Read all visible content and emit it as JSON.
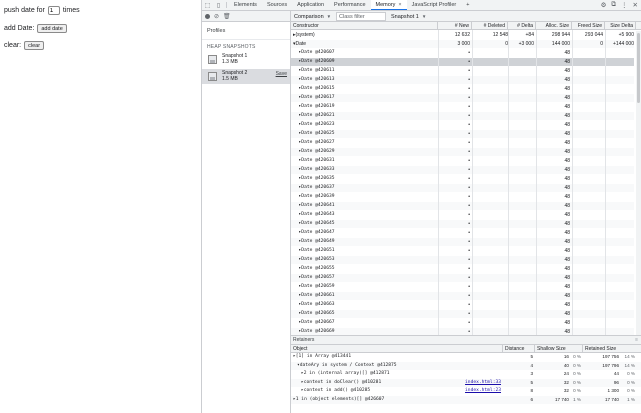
{
  "page": {
    "push_prefix": "push date for",
    "push_count": "1",
    "push_suffix": "times",
    "add_label": "add Date:",
    "add_button": "add date",
    "clear_label": "clear:",
    "clear_button": "clear"
  },
  "devtools": {
    "tabs": [
      {
        "label": "Elements",
        "active": false
      },
      {
        "label": "Sources",
        "active": false
      },
      {
        "label": "Application",
        "active": false
      },
      {
        "label": "Performance",
        "active": false
      },
      {
        "label": "Memory",
        "active": true
      },
      {
        "label": "JavaScript Profiler",
        "active": false
      }
    ],
    "add_tab": "+",
    "close_tab": "×",
    "toolbar": {
      "view_select": "Comparison",
      "class_filter_placeholder": "Class filter",
      "snapshot_select": "Snapshot 1"
    },
    "profiles": {
      "title": "Profiles",
      "heading": "HEAP SNAPSHOTS",
      "snapshots": [
        {
          "name": "Snapshot 1",
          "size": "1.3 MB"
        },
        {
          "name": "Snapshot 2",
          "size": "1.5 MB",
          "save": "Save"
        }
      ]
    },
    "table": {
      "headers": [
        "Constructor",
        "# New",
        "# Deleted",
        "# Delta",
        "Alloc. Size",
        "Freed Size",
        "Size Delta"
      ],
      "summary_rows": [
        {
          "name": "(system)",
          "new": "12 632",
          "deleted": "12 548",
          "delta": "+84",
          "alloc": "298 944",
          "freed": "293 044",
          "sdelta": "+5 900"
        },
        {
          "name": "Date",
          "new": "3 000",
          "deleted": "0",
          "delta": "+3 000",
          "alloc": "144 000",
          "freed": "0",
          "sdelta": "+144 000"
        }
      ],
      "date_rows": [
        "Date @420607",
        "Date @420609",
        "Date @420611",
        "Date @420613",
        "Date @420615",
        "Date @420617",
        "Date @420619",
        "Date @420621",
        "Date @420623",
        "Date @420625",
        "Date @420627",
        "Date @420629",
        "Date @420631",
        "Date @420633",
        "Date @420635",
        "Date @420637",
        "Date @420639",
        "Date @420641",
        "Date @420643",
        "Date @420645",
        "Date @420647",
        "Date @420649",
        "Date @420651",
        "Date @420653",
        "Date @420655",
        "Date @420657",
        "Date @420659",
        "Date @420661",
        "Date @420663",
        "Date @420665",
        "Date @420667",
        "Date @420669"
      ],
      "date_new": "•",
      "date_alloc": "48",
      "selected_row": "Date @420609"
    },
    "retainers": {
      "title": "Retainers",
      "headers": [
        "Object",
        "Distance",
        "Shallow Size",
        "Retained Size"
      ],
      "rows": [
        {
          "object": "▸[1] in Array @413441",
          "link": "",
          "distance": "5",
          "shallow": "16",
          "spct": "0 %",
          "retained": "197 756",
          "rpct": "14 %"
        },
        {
          "object": "▾dateAry in system / Context @412875",
          "link": "",
          "distance": "4",
          "shallow": "40",
          "spct": "0 %",
          "retained": "197 796",
          "rpct": "14 %"
        },
        {
          "object": "▸2 in (internal array)[] @412871",
          "link": "",
          "distance": "3",
          "shallow": "24",
          "spct": "0 %",
          "retained": "44",
          "rpct": "0 %"
        },
        {
          "object": "▸context in doClear() @410281",
          "link": "index.html:33",
          "distance": "5",
          "shallow": "32",
          "spct": "0 %",
          "retained": "96",
          "rpct": "0 %"
        },
        {
          "object": "▸context in add() @410285",
          "link": "index.html:23",
          "distance": "8",
          "shallow": "32",
          "spct": "0 %",
          "retained": "1 300",
          "rpct": "0 %"
        },
        {
          "object": "▸1 in (object elements)[] @426607",
          "link": "",
          "distance": "6",
          "shallow": "17 740",
          "spct": "1 %",
          "retained": "17 740",
          "rpct": "1 %"
        }
      ]
    }
  }
}
